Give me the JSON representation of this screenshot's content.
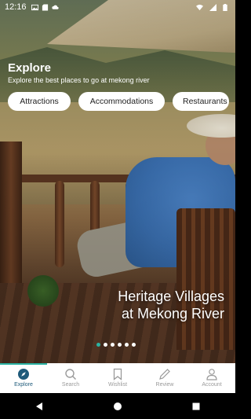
{
  "status_bar": {
    "time": "12:16",
    "left_icons": [
      "gallery-icon",
      "sd-card-icon",
      "cloud-icon"
    ],
    "right_icons": [
      "wifi-icon",
      "signal-icon",
      "battery-icon"
    ]
  },
  "explore": {
    "title": "Explore",
    "subtitle": "Explore the best places to go at mekong river"
  },
  "categories": [
    {
      "label": "Attractions"
    },
    {
      "label": "Accommodations"
    },
    {
      "label": "Restaurants"
    }
  ],
  "hero": {
    "caption_line1": "Heritage Villages",
    "caption_line2": "at Mekong River",
    "slide_count": 6,
    "active_slide": 1
  },
  "bottom_nav": [
    {
      "label": "Explore",
      "icon": "compass-icon",
      "active": true
    },
    {
      "label": "Search",
      "icon": "search-icon",
      "active": false
    },
    {
      "label": "Wishlist",
      "icon": "bookmark-icon",
      "active": false
    },
    {
      "label": "Review",
      "icon": "pencil-icon",
      "active": false
    },
    {
      "label": "Account",
      "icon": "user-icon",
      "active": false
    }
  ],
  "colors": {
    "accent": "#2bb3a3",
    "active_nav": "#1e5a7a",
    "inactive_nav": "#9a9a9a"
  }
}
